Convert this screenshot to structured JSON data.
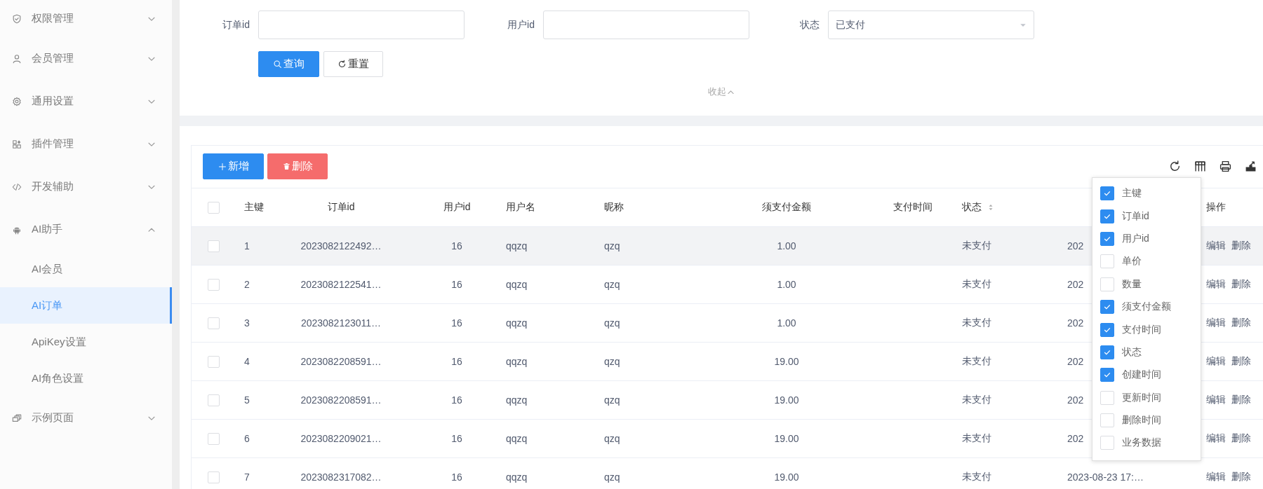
{
  "sidebar": {
    "items": [
      {
        "label": "权限管理",
        "expanded": false
      },
      {
        "label": "会员管理",
        "expanded": false
      },
      {
        "label": "通用设置",
        "expanded": false
      },
      {
        "label": "插件管理",
        "expanded": false
      },
      {
        "label": "开发辅助",
        "expanded": false
      },
      {
        "label": "AI助手",
        "expanded": true,
        "children": [
          {
            "label": "AI会员",
            "selected": false
          },
          {
            "label": "AI订单",
            "selected": true
          },
          {
            "label": "ApiKey设置",
            "selected": false
          },
          {
            "label": "AI角色设置",
            "selected": false
          }
        ]
      },
      {
        "label": "示例页面",
        "expanded": false
      }
    ]
  },
  "search_form": {
    "fields": [
      {
        "kind": "input",
        "label": "订单id"
      },
      {
        "kind": "input",
        "label": "用户id"
      },
      {
        "kind": "select",
        "label": "状态",
        "value": "已支付"
      }
    ],
    "search_button": "查询",
    "reset_button": "重置",
    "collapse_link": "收起"
  },
  "toolbar": {
    "add_button": "新增",
    "delete_button": "删除"
  },
  "table": {
    "header_checked": false,
    "columns": [
      {
        "label": "主键"
      },
      {
        "label": "订单id"
      },
      {
        "label": "用户id"
      },
      {
        "label": "用户名"
      },
      {
        "label": "昵称"
      },
      {
        "label": "须支付金额"
      },
      {
        "label": "支付时间"
      },
      {
        "label": "状态",
        "sortable": true
      },
      {},
      {
        "label": "操作"
      }
    ],
    "rows": [
      {
        "checked": false,
        "highlighted": true,
        "cells": [
          "1",
          "2023082122492…",
          "16",
          "qqzq",
          "qzq",
          "1.00",
          "",
          "未支付",
          "202"
        ],
        "actions": [
          "编辑",
          "删除"
        ]
      },
      {
        "checked": false,
        "highlighted": false,
        "cells": [
          "2",
          "2023082122541…",
          "16",
          "qqzq",
          "qzq",
          "1.00",
          "",
          "未支付",
          "202"
        ],
        "actions": [
          "编辑",
          "删除"
        ]
      },
      {
        "checked": false,
        "highlighted": false,
        "cells": [
          "3",
          "2023082123011…",
          "16",
          "qqzq",
          "qzq",
          "1.00",
          "",
          "未支付",
          "202"
        ],
        "actions": [
          "编辑",
          "删除"
        ]
      },
      {
        "checked": false,
        "highlighted": false,
        "cells": [
          "4",
          "2023082208591…",
          "16",
          "qqzq",
          "qzq",
          "19.00",
          "",
          "未支付",
          "202"
        ],
        "actions": [
          "编辑",
          "删除"
        ]
      },
      {
        "checked": false,
        "highlighted": false,
        "cells": [
          "5",
          "2023082208591…",
          "16",
          "qqzq",
          "qzq",
          "19.00",
          "",
          "未支付",
          "202"
        ],
        "actions": [
          "编辑",
          "删除"
        ]
      },
      {
        "checked": false,
        "highlighted": false,
        "cells": [
          "6",
          "2023082209021…",
          "16",
          "qqzq",
          "qzq",
          "19.00",
          "",
          "未支付",
          "202"
        ],
        "actions": [
          "编辑",
          "删除"
        ]
      },
      {
        "checked": false,
        "highlighted": false,
        "cells": [
          "7",
          "2023082317082…",
          "16",
          "qqzq",
          "qzq",
          "19.00",
          "",
          "未支付",
          "2023-08-23 17:…"
        ],
        "actions": [
          "编辑",
          "删除"
        ]
      }
    ]
  },
  "column_menu": {
    "items": [
      {
        "label": "主键",
        "checked": true
      },
      {
        "label": "订单id",
        "checked": true
      },
      {
        "label": "用户id",
        "checked": true
      },
      {
        "label": "单价",
        "checked": false
      },
      {
        "label": "数量",
        "checked": false
      },
      {
        "label": "须支付金额",
        "checked": true
      },
      {
        "label": "支付时间",
        "checked": true
      },
      {
        "label": "状态",
        "checked": true
      },
      {
        "label": "创建时间",
        "checked": true
      },
      {
        "label": "更新时间",
        "checked": false
      },
      {
        "label": "删除时间",
        "checked": false
      },
      {
        "label": "业务数据",
        "checked": false
      }
    ]
  }
}
